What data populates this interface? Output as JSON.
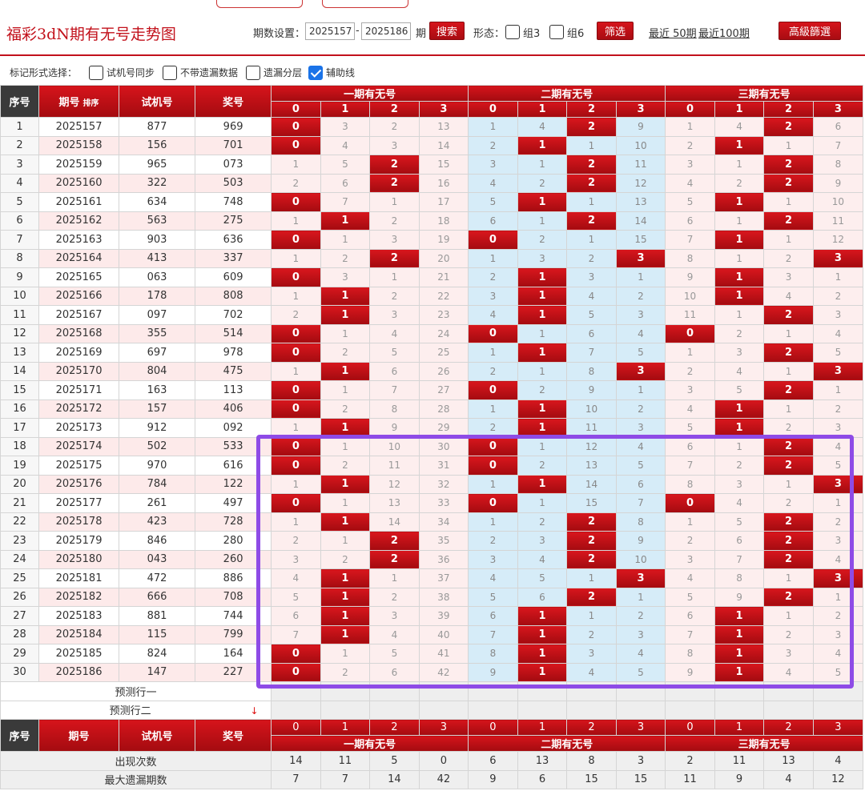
{
  "header": {
    "title": "福彩3dN期有无号走势图",
    "period_label": "期数设置：",
    "period_from": "2025157",
    "period_dash": "-",
    "period_to": "2025186",
    "period_suffix": "期",
    "search_label": "搜索",
    "form_label": "形态：",
    "zu3_label": "组3",
    "zu6_label": "组6",
    "filter_label": "筛选",
    "recent50": "最近 50期",
    "recent100": "最近100期",
    "advanced_label": "高級篩選"
  },
  "mark_options": {
    "title": "标记形式选择：",
    "opt1": "试机号同步",
    "opt2": "不带遗漏数据",
    "opt3": "遗漏分层",
    "opt4": "辅助线",
    "opt4_checked": true
  },
  "table": {
    "col_seq": "序号",
    "col_period": "期号",
    "col_period_sort": "排序",
    "col_trial": "试机号",
    "col_prize": "奖号",
    "groups": [
      "一期有无号",
      "二期有无号",
      "三期有无号"
    ],
    "sub_cols": [
      "0",
      "1",
      "2",
      "3"
    ],
    "rows": [
      {
        "seq": "1",
        "period": "2025157",
        "trial": "877",
        "prize": "969",
        "g": [
          [
            "0",
            "3",
            "2",
            "13"
          ],
          [
            "1",
            "4",
            "2",
            "9"
          ],
          [
            "1",
            "4",
            "2",
            "6"
          ]
        ],
        "h": [
          0,
          -1,
          -1,
          -1,
          -1,
          -1,
          2,
          -1,
          -1,
          -1,
          2,
          -1
        ]
      },
      {
        "seq": "2",
        "period": "2025158",
        "trial": "156",
        "prize": "701",
        "g": [
          [
            "0",
            "4",
            "3",
            "14"
          ],
          [
            "2",
            "1",
            "1",
            "10"
          ],
          [
            "2",
            "1",
            "1",
            "7"
          ]
        ],
        "h": [
          0,
          -1,
          -1,
          -1,
          -1,
          1,
          -1,
          -1,
          -1,
          1,
          -1,
          -1
        ]
      },
      {
        "seq": "3",
        "period": "2025159",
        "trial": "965",
        "prize": "073",
        "g": [
          [
            "1",
            "5",
            "2",
            "15"
          ],
          [
            "3",
            "1",
            "2",
            "11"
          ],
          [
            "3",
            "1",
            "2",
            "8"
          ]
        ],
        "h": [
          -1,
          -1,
          2,
          -1,
          -1,
          -1,
          2,
          -1,
          -1,
          -1,
          2,
          -1
        ]
      },
      {
        "seq": "4",
        "period": "2025160",
        "trial": "322",
        "prize": "503",
        "g": [
          [
            "2",
            "6",
            "2",
            "16"
          ],
          [
            "4",
            "2",
            "2",
            "12"
          ],
          [
            "4",
            "2",
            "2",
            "9"
          ]
        ],
        "h": [
          -1,
          -1,
          2,
          -1,
          -1,
          -1,
          2,
          -1,
          -1,
          -1,
          2,
          -1
        ]
      },
      {
        "seq": "5",
        "period": "2025161",
        "trial": "634",
        "prize": "748",
        "g": [
          [
            "0",
            "7",
            "1",
            "17"
          ],
          [
            "5",
            "1",
            "1",
            "13"
          ],
          [
            "5",
            "1",
            "1",
            "10"
          ]
        ],
        "h": [
          0,
          -1,
          -1,
          -1,
          -1,
          1,
          -1,
          -1,
          -1,
          1,
          -1,
          -1
        ]
      },
      {
        "seq": "6",
        "period": "2025162",
        "trial": "563",
        "prize": "275",
        "g": [
          [
            "1",
            "1",
            "2",
            "18"
          ],
          [
            "6",
            "1",
            "2",
            "14"
          ],
          [
            "6",
            "1",
            "2",
            "11"
          ]
        ],
        "h": [
          -1,
          1,
          -1,
          -1,
          -1,
          -1,
          2,
          -1,
          -1,
          -1,
          2,
          -1
        ]
      },
      {
        "seq": "7",
        "period": "2025163",
        "trial": "903",
        "prize": "636",
        "g": [
          [
            "0",
            "1",
            "3",
            "19"
          ],
          [
            "0",
            "2",
            "1",
            "15"
          ],
          [
            "7",
            "1",
            "1",
            "12"
          ]
        ],
        "h": [
          0,
          -1,
          -1,
          -1,
          0,
          -1,
          -1,
          -1,
          -1,
          1,
          -1,
          -1
        ]
      },
      {
        "seq": "8",
        "period": "2025164",
        "trial": "413",
        "prize": "337",
        "g": [
          [
            "1",
            "2",
            "2",
            "20"
          ],
          [
            "1",
            "3",
            "2",
            "3"
          ],
          [
            "8",
            "1",
            "2",
            "3"
          ]
        ],
        "h": [
          -1,
          -1,
          2,
          -1,
          -1,
          -1,
          -1,
          3,
          -1,
          -1,
          -1,
          3
        ]
      },
      {
        "seq": "9",
        "period": "2025165",
        "trial": "063",
        "prize": "609",
        "g": [
          [
            "0",
            "3",
            "1",
            "21"
          ],
          [
            "2",
            "1",
            "3",
            "1"
          ],
          [
            "9",
            "1",
            "3",
            "1"
          ]
        ],
        "h": [
          0,
          -1,
          -1,
          -1,
          -1,
          1,
          -1,
          -1,
          -1,
          1,
          -1,
          -1
        ]
      },
      {
        "seq": "10",
        "period": "2025166",
        "trial": "178",
        "prize": "808",
        "g": [
          [
            "1",
            "1",
            "2",
            "22"
          ],
          [
            "3",
            "1",
            "4",
            "2"
          ],
          [
            "10",
            "1",
            "4",
            "2"
          ]
        ],
        "h": [
          -1,
          1,
          -1,
          -1,
          -1,
          1,
          -1,
          -1,
          -1,
          1,
          -1,
          -1
        ]
      },
      {
        "seq": "11",
        "period": "2025167",
        "trial": "097",
        "prize": "702",
        "g": [
          [
            "2",
            "1",
            "3",
            "23"
          ],
          [
            "4",
            "1",
            "5",
            "3"
          ],
          [
            "11",
            "1",
            "2",
            "3"
          ]
        ],
        "h": [
          -1,
          1,
          -1,
          -1,
          -1,
          1,
          -1,
          -1,
          -1,
          -1,
          2,
          -1
        ]
      },
      {
        "seq": "12",
        "period": "2025168",
        "trial": "355",
        "prize": "514",
        "g": [
          [
            "0",
            "1",
            "4",
            "24"
          ],
          [
            "0",
            "1",
            "6",
            "4"
          ],
          [
            "0",
            "2",
            "1",
            "4"
          ]
        ],
        "h": [
          0,
          -1,
          -1,
          -1,
          0,
          -1,
          -1,
          -1,
          0,
          -1,
          -1,
          -1
        ]
      },
      {
        "seq": "13",
        "period": "2025169",
        "trial": "697",
        "prize": "978",
        "g": [
          [
            "0",
            "2",
            "5",
            "25"
          ],
          [
            "1",
            "1",
            "7",
            "5"
          ],
          [
            "1",
            "3",
            "2",
            "5"
          ]
        ],
        "h": [
          0,
          -1,
          -1,
          -1,
          -1,
          1,
          -1,
          -1,
          -1,
          -1,
          2,
          -1
        ]
      },
      {
        "seq": "14",
        "period": "2025170",
        "trial": "804",
        "prize": "475",
        "g": [
          [
            "1",
            "1",
            "6",
            "26"
          ],
          [
            "2",
            "1",
            "8",
            "3"
          ],
          [
            "2",
            "4",
            "1",
            "3"
          ]
        ],
        "h": [
          -1,
          1,
          -1,
          -1,
          -1,
          -1,
          -1,
          3,
          -1,
          -1,
          -1,
          3
        ]
      },
      {
        "seq": "15",
        "period": "2025171",
        "trial": "163",
        "prize": "113",
        "g": [
          [
            "0",
            "1",
            "7",
            "27"
          ],
          [
            "0",
            "2",
            "9",
            "1"
          ],
          [
            "3",
            "5",
            "2",
            "1"
          ]
        ],
        "h": [
          0,
          -1,
          -1,
          -1,
          0,
          -1,
          -1,
          -1,
          -1,
          -1,
          2,
          -1
        ]
      },
      {
        "seq": "16",
        "period": "2025172",
        "trial": "157",
        "prize": "406",
        "g": [
          [
            "0",
            "2",
            "8",
            "28"
          ],
          [
            "1",
            "1",
            "10",
            "2"
          ],
          [
            "4",
            "1",
            "1",
            "2"
          ]
        ],
        "h": [
          0,
          -1,
          -1,
          -1,
          -1,
          1,
          -1,
          -1,
          -1,
          1,
          -1,
          -1
        ]
      },
      {
        "seq": "17",
        "period": "2025173",
        "trial": "912",
        "prize": "092",
        "g": [
          [
            "1",
            "1",
            "9",
            "29"
          ],
          [
            "2",
            "1",
            "11",
            "3"
          ],
          [
            "5",
            "1",
            "2",
            "3"
          ]
        ],
        "h": [
          -1,
          1,
          -1,
          -1,
          -1,
          1,
          -1,
          -1,
          -1,
          1,
          -1,
          -1
        ]
      },
      {
        "seq": "18",
        "period": "2025174",
        "trial": "502",
        "prize": "533",
        "g": [
          [
            "0",
            "1",
            "10",
            "30"
          ],
          [
            "0",
            "1",
            "12",
            "4"
          ],
          [
            "6",
            "1",
            "2",
            "4"
          ]
        ],
        "h": [
          0,
          -1,
          -1,
          -1,
          0,
          -1,
          -1,
          -1,
          -1,
          -1,
          2,
          -1
        ]
      },
      {
        "seq": "19",
        "period": "2025175",
        "trial": "970",
        "prize": "616",
        "g": [
          [
            "0",
            "2",
            "11",
            "31"
          ],
          [
            "0",
            "2",
            "13",
            "5"
          ],
          [
            "7",
            "2",
            "2",
            "5"
          ]
        ],
        "h": [
          0,
          -1,
          -1,
          -1,
          0,
          -1,
          -1,
          -1,
          -1,
          -1,
          2,
          -1
        ]
      },
      {
        "seq": "20",
        "period": "2025176",
        "trial": "784",
        "prize": "122",
        "g": [
          [
            "1",
            "1",
            "12",
            "32"
          ],
          [
            "1",
            "1",
            "14",
            "6"
          ],
          [
            "8",
            "3",
            "1",
            "3"
          ]
        ],
        "h": [
          -1,
          1,
          -1,
          -1,
          -1,
          1,
          -1,
          -1,
          -1,
          -1,
          -1,
          3
        ]
      },
      {
        "seq": "21",
        "period": "2025177",
        "trial": "261",
        "prize": "497",
        "g": [
          [
            "0",
            "1",
            "13",
            "33"
          ],
          [
            "0",
            "1",
            "15",
            "7"
          ],
          [
            "0",
            "4",
            "2",
            "1"
          ]
        ],
        "h": [
          0,
          -1,
          -1,
          -1,
          0,
          -1,
          -1,
          -1,
          0,
          -1,
          -1,
          -1
        ]
      },
      {
        "seq": "22",
        "period": "2025178",
        "trial": "423",
        "prize": "728",
        "g": [
          [
            "1",
            "1",
            "14",
            "34"
          ],
          [
            "1",
            "2",
            "2",
            "8"
          ],
          [
            "1",
            "5",
            "2",
            "2"
          ]
        ],
        "h": [
          -1,
          1,
          -1,
          -1,
          -1,
          -1,
          2,
          -1,
          -1,
          -1,
          2,
          -1
        ]
      },
      {
        "seq": "23",
        "period": "2025179",
        "trial": "846",
        "prize": "280",
        "g": [
          [
            "2",
            "1",
            "2",
            "35"
          ],
          [
            "2",
            "3",
            "2",
            "9"
          ],
          [
            "2",
            "6",
            "2",
            "3"
          ]
        ],
        "h": [
          -1,
          -1,
          2,
          -1,
          -1,
          -1,
          2,
          -1,
          -1,
          -1,
          2,
          -1
        ]
      },
      {
        "seq": "24",
        "period": "2025180",
        "trial": "043",
        "prize": "260",
        "g": [
          [
            "3",
            "2",
            "2",
            "36"
          ],
          [
            "3",
            "4",
            "2",
            "10"
          ],
          [
            "3",
            "7",
            "2",
            "4"
          ]
        ],
        "h": [
          -1,
          -1,
          2,
          -1,
          -1,
          -1,
          2,
          -1,
          -1,
          -1,
          2,
          -1
        ]
      },
      {
        "seq": "25",
        "period": "2025181",
        "trial": "472",
        "prize": "886",
        "g": [
          [
            "4",
            "1",
            "1",
            "37"
          ],
          [
            "4",
            "5",
            "1",
            "3"
          ],
          [
            "4",
            "8",
            "1",
            "3"
          ]
        ],
        "h": [
          -1,
          1,
          -1,
          -1,
          -1,
          -1,
          -1,
          3,
          -1,
          -1,
          -1,
          3
        ]
      },
      {
        "seq": "26",
        "period": "2025182",
        "trial": "666",
        "prize": "708",
        "g": [
          [
            "5",
            "1",
            "2",
            "38"
          ],
          [
            "5",
            "6",
            "2",
            "1"
          ],
          [
            "5",
            "9",
            "2",
            "1"
          ]
        ],
        "h": [
          -1,
          1,
          -1,
          -1,
          -1,
          -1,
          2,
          -1,
          -1,
          -1,
          2,
          -1
        ]
      },
      {
        "seq": "27",
        "period": "2025183",
        "trial": "881",
        "prize": "744",
        "g": [
          [
            "6",
            "1",
            "3",
            "39"
          ],
          [
            "6",
            "1",
            "1",
            "2"
          ],
          [
            "6",
            "1",
            "1",
            "2"
          ]
        ],
        "h": [
          -1,
          1,
          -1,
          -1,
          -1,
          1,
          -1,
          -1,
          -1,
          1,
          -1,
          -1
        ]
      },
      {
        "seq": "28",
        "period": "2025184",
        "trial": "115",
        "prize": "799",
        "g": [
          [
            "7",
            "1",
            "4",
            "40"
          ],
          [
            "7",
            "1",
            "2",
            "3"
          ],
          [
            "7",
            "1",
            "2",
            "3"
          ]
        ],
        "h": [
          -1,
          1,
          -1,
          -1,
          -1,
          1,
          -1,
          -1,
          -1,
          1,
          -1,
          -1
        ]
      },
      {
        "seq": "29",
        "period": "2025185",
        "trial": "824",
        "prize": "164",
        "g": [
          [
            "0",
            "1",
            "5",
            "41"
          ],
          [
            "8",
            "1",
            "3",
            "4"
          ],
          [
            "8",
            "1",
            "3",
            "4"
          ]
        ],
        "h": [
          0,
          -1,
          -1,
          -1,
          -1,
          1,
          -1,
          -1,
          -1,
          1,
          -1,
          -1
        ]
      },
      {
        "seq": "30",
        "period": "2025186",
        "trial": "147",
        "prize": "227",
        "g": [
          [
            "0",
            "2",
            "6",
            "42"
          ],
          [
            "9",
            "1",
            "4",
            "5"
          ],
          [
            "9",
            "1",
            "4",
            "5"
          ]
        ],
        "h": [
          0,
          -1,
          -1,
          -1,
          -1,
          1,
          -1,
          -1,
          -1,
          1,
          -1,
          -1
        ]
      }
    ],
    "predict1": "预测行一",
    "predict2": "预测行二",
    "stats": [
      {
        "label": "出现次数",
        "values": [
          "14",
          "11",
          "5",
          "0",
          "6",
          "13",
          "8",
          "3",
          "2",
          "11",
          "13",
          "4"
        ]
      },
      {
        "label": "最大遗漏期数",
        "values": [
          "7",
          "7",
          "14",
          "42",
          "9",
          "6",
          "15",
          "15",
          "11",
          "9",
          "4",
          "12"
        ]
      }
    ]
  },
  "colors": {
    "accent_red": "#c2111b",
    "highlight_purple": "#8e4be6",
    "blue_bg": "#d6ecf8",
    "pink_bg": "#fdeeee"
  }
}
